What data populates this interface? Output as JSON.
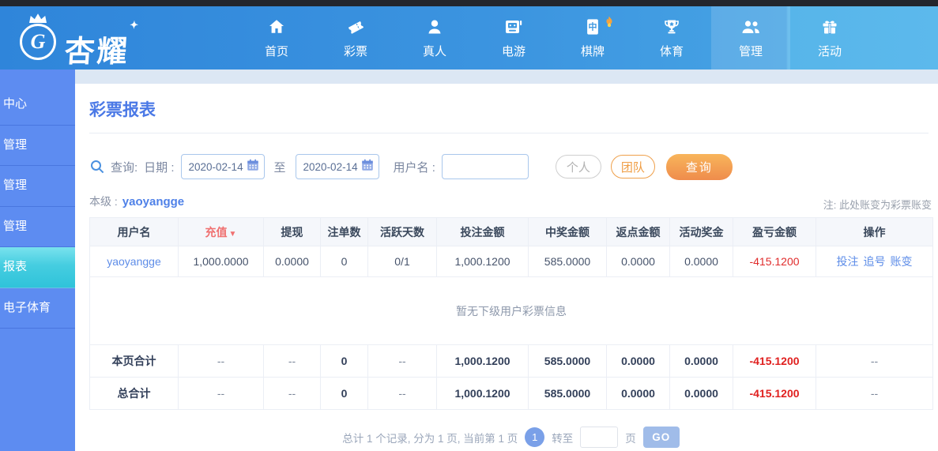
{
  "navbar": {
    "brand": "杏耀",
    "brand_initial": "G",
    "tile_char": "中",
    "items": [
      {
        "label": "首页"
      },
      {
        "label": "彩票"
      },
      {
        "label": "真人"
      },
      {
        "label": "电游"
      },
      {
        "label": "棋牌"
      },
      {
        "label": "体育"
      },
      {
        "label": "管理"
      },
      {
        "label": "活动"
      }
    ]
  },
  "sidebar": {
    "items": [
      {
        "label": "中心"
      },
      {
        "label": "管理"
      },
      {
        "label": "管理"
      },
      {
        "label": "管理"
      },
      {
        "label": "报表"
      },
      {
        "label": "电子体育"
      }
    ]
  },
  "page": {
    "title": "彩票报表",
    "search": {
      "query_label": "查询:",
      "date_label": "日期 :",
      "date_from": "2020-02-14",
      "to_label": "至",
      "date_to": "2020-02-14",
      "username_label": "用户名 :",
      "username_value": "",
      "personal_button": "个人",
      "team_button": "团队",
      "query_button": "查询"
    },
    "level_label": "本级 :",
    "level_value": "yaoyangge",
    "note": "注: 此处账变为彩票账变"
  },
  "table": {
    "columns": [
      "用户名",
      "充值",
      "提现",
      "注单数",
      "活跃天数",
      "投注金额",
      "中奖金额",
      "返点金额",
      "活动奖金",
      "盈亏金额",
      "操作"
    ],
    "sort_indicator": "▼",
    "row": {
      "cells": [
        "yaoyangge",
        "1,000.0000",
        "0.0000",
        "0",
        "0/1",
        "1,000.1200",
        "585.0000",
        "0.0000",
        "0.0000",
        "-415.1200"
      ],
      "actions": [
        "投注",
        "追号",
        "账变"
      ]
    },
    "empty_message": "暂无下级用户彩票信息",
    "page_total": {
      "cells": [
        "本页合计",
        "--",
        "--",
        "0",
        "--",
        "1,000.1200",
        "585.0000",
        "0.0000",
        "0.0000",
        "-415.1200",
        "--"
      ]
    },
    "grand_total": {
      "cells": [
        "总合计",
        "--",
        "--",
        "0",
        "--",
        "1,000.1200",
        "585.0000",
        "0.0000",
        "0.0000",
        "-415.1200",
        "--"
      ]
    }
  },
  "pagination": {
    "summary": "总计 1 个记录, 分为 1 页, 当前第 1 页",
    "current_page": "1",
    "goto_label": "转至",
    "goto_value": "",
    "page_unit": "页",
    "go_button": "GO"
  },
  "colors": {
    "nav_blue": "#3f99e1",
    "sidebar_blue": "#5d8cf1",
    "active_cyan": "#3cc9dd",
    "accent_orange": "#ef9d43",
    "link_blue": "#5e8de8",
    "negative_red": "#e02b2b"
  }
}
